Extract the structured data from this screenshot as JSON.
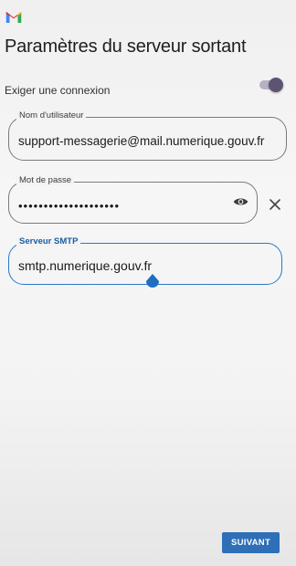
{
  "app": {
    "logo_icon": "gmail-m-icon"
  },
  "page": {
    "title": "Paramètres du serveur sortant"
  },
  "require_login": {
    "label": "Exiger une connexion",
    "enabled": true
  },
  "fields": {
    "username": {
      "label": "Nom d'utilisateur",
      "value": "support-messagerie@mail.numerique.gouv.fr"
    },
    "password": {
      "label": "Mot de passe",
      "value": "••••••••••••••••••••",
      "toggle_icon": "eye-icon",
      "clear_icon": "close-icon"
    },
    "smtp_server": {
      "label": "Serveur SMTP",
      "value": "smtp.numerique.gouv.fr"
    }
  },
  "actions": {
    "next_label": "SUIVANT"
  },
  "colors": {
    "accent": "#2e6fb7",
    "focus_outline": "#2a78c8",
    "toggle_thumb": "#5d5472"
  }
}
